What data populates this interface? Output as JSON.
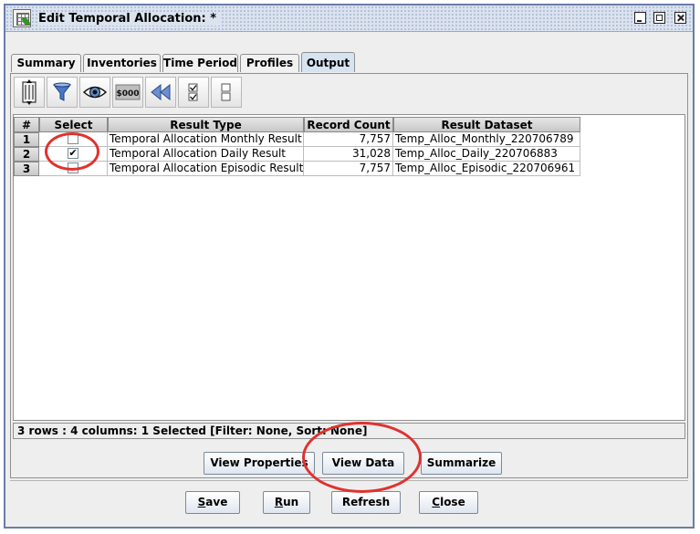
{
  "window": {
    "title": "Edit Temporal Allocation:  *"
  },
  "tabs": [
    {
      "label": "Summary",
      "active": false
    },
    {
      "label": "Inventories",
      "active": false
    },
    {
      "label": "Time Period",
      "active": false
    },
    {
      "label": "Profiles",
      "active": false
    },
    {
      "label": "Output",
      "active": true
    }
  ],
  "toolbar": {
    "buttons": [
      {
        "icon": "sort-icon"
      },
      {
        "icon": "filter-icon"
      },
      {
        "icon": "eye-icon"
      },
      {
        "icon": "format-money-icon",
        "label": "$000"
      },
      {
        "icon": "reset-rewind-icon"
      },
      {
        "icon": "select-all-icon"
      },
      {
        "icon": "clear-selection-icon"
      }
    ]
  },
  "table": {
    "columns": [
      "#",
      "Select",
      "Result Type",
      "Record Count",
      "Result Dataset"
    ],
    "rows": [
      {
        "num": "1",
        "selected": false,
        "result_type": "Temporal Allocation Monthly Result",
        "record_count": "7,757",
        "dataset": "Temp_Alloc_Monthly_220706789"
      },
      {
        "num": "2",
        "selected": true,
        "result_type": "Temporal Allocation Daily Result",
        "record_count": "31,028",
        "dataset": "Temp_Alloc_Daily_220706883"
      },
      {
        "num": "3",
        "selected": false,
        "result_type": "Temporal Allocation Episodic Result",
        "record_count": "7,757",
        "dataset": "Temp_Alloc_Episodic_220706961"
      }
    ]
  },
  "status": "3 rows : 4 columns: 1 Selected [Filter: None, Sort: None]",
  "actions": {
    "view_properties": "View Properties",
    "view_data": "View Data",
    "summarize": "Summarize"
  },
  "footer": {
    "save_first": "S",
    "save_rest": "ave",
    "run_first": "R",
    "run_rest": "un",
    "refresh": "Refresh",
    "close_first": "C",
    "close_rest": "lose"
  },
  "colors": {
    "highlight_ring": "#e0322e",
    "active_tab": "#d6e3f1",
    "title_bar": "#dbe3ef"
  }
}
